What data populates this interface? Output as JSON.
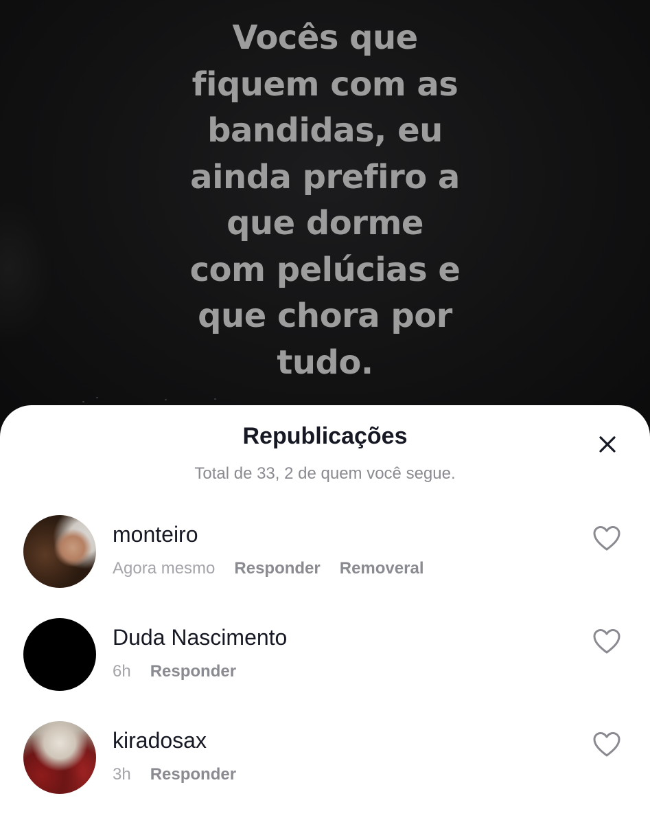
{
  "video": {
    "caption_lines": [
      "Vocês que",
      "fiquem com as",
      "bandidas, eu",
      "ainda prefiro a",
      "que dorme",
      "com pelúcias e",
      "que chora por",
      "tudo."
    ]
  },
  "sheet": {
    "title": "Republicações",
    "summary": "Total de 33, 2 de quem você segue.",
    "close_icon": "close-icon"
  },
  "reposts": [
    {
      "username": "monteiro",
      "time": "Agora mesmo",
      "reply_label": "Responder",
      "remove_label": "Removeral"
    },
    {
      "username": "Duda Nascimento",
      "time": "6h",
      "reply_label": "Responder"
    },
    {
      "username": "kiradosax",
      "time": "3h",
      "reply_label": "Responder"
    }
  ],
  "colors": {
    "sheet_bg": "#ffffff",
    "primary_text": "#161823",
    "secondary_text": "#8a8b91",
    "overlay_text": "#9d9d9d"
  },
  "icons": {
    "like": "heart-outline-icon",
    "close": "close-icon"
  }
}
